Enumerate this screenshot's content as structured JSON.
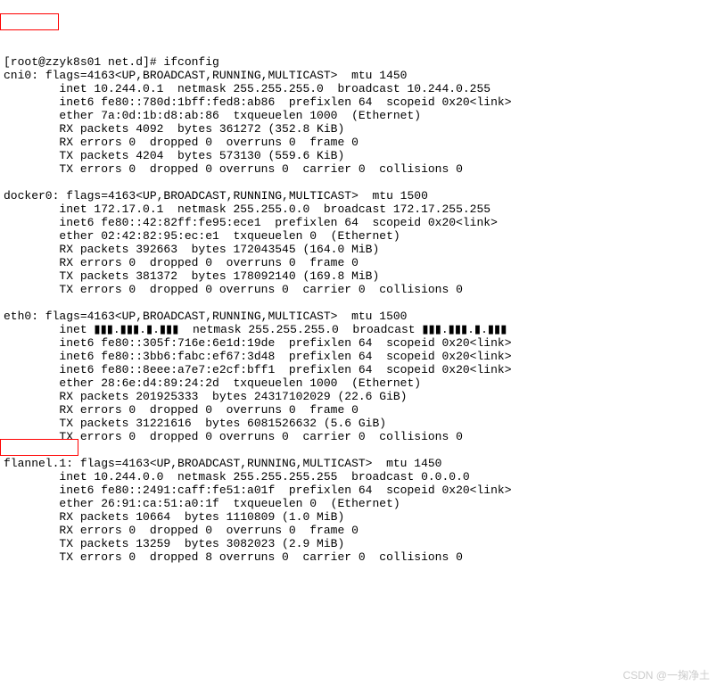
{
  "prompt": "[root@zzyk8s01 net.d]# ifconfig",
  "cni0": {
    "name": "cni0:",
    "flags": " flags=4163<UP,BROADCAST,RUNNING,MULTICAST>  mtu 1450",
    "inet": "        inet 10.244.0.1  netmask 255.255.255.0  broadcast 10.244.0.255",
    "inet6": "        inet6 fe80::780d:1bff:fed8:ab86  prefixlen 64  scopeid 0x20<link>",
    "ether": "        ether 7a:0d:1b:d8:ab:86  txqueuelen 1000  (Ethernet)",
    "rxp": "        RX packets 4092  bytes 361272 (352.8 KiB)",
    "rxe": "        RX errors 0  dropped 0  overruns 0  frame 0",
    "txp": "        TX packets 4204  bytes 573130 (559.6 KiB)",
    "txe": "        TX errors 0  dropped 0 overruns 0  carrier 0  collisions 0"
  },
  "docker0": {
    "head": "docker0: flags=4163<UP,BROADCAST,RUNNING,MULTICAST>  mtu 1500",
    "inet": "        inet 172.17.0.1  netmask 255.255.0.0  broadcast 172.17.255.255",
    "inet6": "        inet6 fe80::42:82ff:fe95:ece1  prefixlen 64  scopeid 0x20<link>",
    "ether": "        ether 02:42:82:95:ec:e1  txqueuelen 0  (Ethernet)",
    "rxp": "        RX packets 392663  bytes 172043545 (164.0 MiB)",
    "rxe": "        RX errors 0  dropped 0  overruns 0  frame 0",
    "txp": "        TX packets 381372  bytes 178092140 (169.8 MiB)",
    "txe": "        TX errors 0  dropped 0 overruns 0  carrier 0  collisions 0"
  },
  "eth0": {
    "head": "eth0: flags=4163<UP,BROADCAST,RUNNING,MULTICAST>  mtu 1500",
    "inet": "        inet ▮▮▮.▮▮▮.▮.▮▮▮  netmask 255.255.255.0  broadcast ▮▮▮.▮▮▮.▮.▮▮▮",
    "inet6a": "        inet6 fe80::305f:716e:6e1d:19de  prefixlen 64  scopeid 0x20<link>",
    "inet6b": "        inet6 fe80::3bb6:fabc:ef67:3d48  prefixlen 64  scopeid 0x20<link>",
    "inet6c": "        inet6 fe80::8eee:a7e7:e2cf:bff1  prefixlen 64  scopeid 0x20<link>",
    "ether": "        ether 28:6e:d4:89:24:2d  txqueuelen 1000  (Ethernet)",
    "rxp": "        RX packets 201925333  bytes 24317102029 (22.6 GiB)",
    "rxe": "        RX errors 0  dropped 0  overruns 0  frame 0",
    "txp": "        TX packets 31221616  bytes 6081526632 (5.6 GiB)",
    "txe": "        TX errors 0  dropped 0 overruns 0  carrier 0  collisions 0"
  },
  "flannel": {
    "name": "flannel.1:",
    "flags": " flags=4163<UP,BROADCAST,RUNNING,MULTICAST>  mtu 1450",
    "inet": "        inet 10.244.0.0  netmask 255.255.255.255  broadcast 0.0.0.0",
    "inet6": "        inet6 fe80::2491:caff:fe51:a01f  prefixlen 64  scopeid 0x20<link>",
    "ether": "        ether 26:91:ca:51:a0:1f  txqueuelen 0  (Ethernet)",
    "rxp": "        RX packets 10664  bytes 1110809 (1.0 MiB)",
    "rxe": "        RX errors 0  dropped 0  overruns 0  frame 0",
    "txp": "        TX packets 13259  bytes 3082023 (2.9 MiB)",
    "txe": "        TX errors 0  dropped 8 overruns 0  carrier 0  collisions 0"
  },
  "watermark": "CSDN @一掬净土"
}
